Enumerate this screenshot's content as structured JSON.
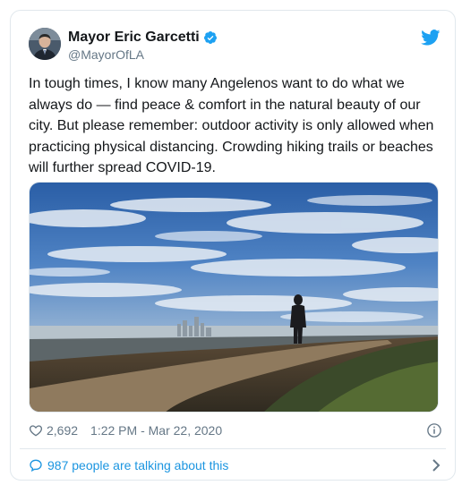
{
  "author": {
    "name": "Mayor Eric Garcetti",
    "handle": "@MayorOfLA"
  },
  "tweet": {
    "text": "In tough times, I know many Angelenos want to do what we\nalways do — find peace & comfort in the natural beauty of our\ncity. But please remember: outdoor activity is only allowed when\npracticing physical distancing. Crowding hiking trails or beaches\nwill further spread COVID-19."
  },
  "stats": {
    "likes": "2,692",
    "timestamp": "1:22 PM - Mar 22, 2020"
  },
  "conversation": {
    "label": "987 people are talking about this"
  },
  "icons": {
    "brand": "twitter-bird-icon",
    "verified": "verified-badge-icon",
    "like": "heart-icon",
    "info": "info-icon",
    "reply": "speech-bubble-icon",
    "chevron": "chevron-right-icon"
  },
  "colors": {
    "brand_blue": "#1da1f2",
    "link_blue": "#1b95e0",
    "secondary_text": "#657786",
    "border": "#e1e8ed"
  }
}
